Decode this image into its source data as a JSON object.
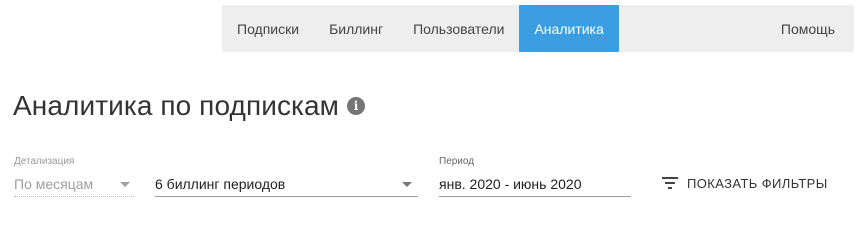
{
  "nav": {
    "items": [
      {
        "label": "Подписки",
        "active": false
      },
      {
        "label": "Биллинг",
        "active": false
      },
      {
        "label": "Пользователи",
        "active": false
      },
      {
        "label": "Аналитика",
        "active": true
      }
    ],
    "help_label": "Помощь"
  },
  "title": {
    "text": "Аналитика по подпискам",
    "info_icon": "info-icon"
  },
  "filters": {
    "detail": {
      "label": "Детализация",
      "value": "По месяцам"
    },
    "periods": {
      "value": "6 биллинг периодов"
    },
    "range": {
      "label": "Период",
      "value": "янв. 2020 - июнь 2020"
    },
    "show_filters_label": "ПОКАЗАТЬ ФИЛЬТРЫ",
    "show_filters_icon": "filter-list-icon"
  },
  "colors": {
    "accent": "#3a9ee1",
    "nav_background": "#eeeeee",
    "text": "#333333",
    "muted": "#9e9e9e"
  }
}
